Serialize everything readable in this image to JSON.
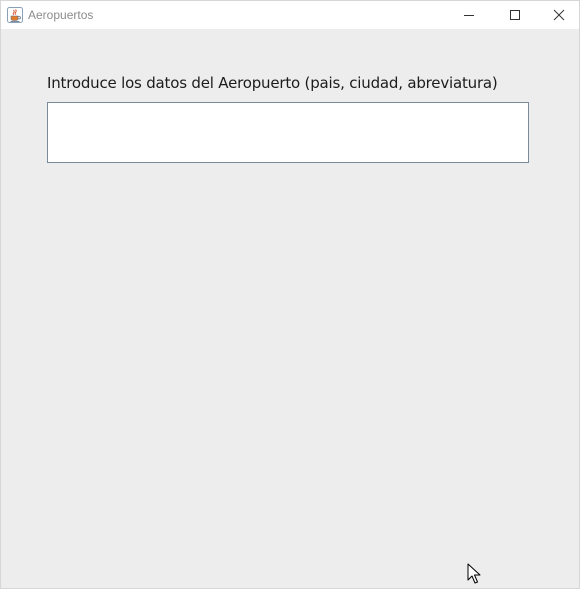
{
  "window": {
    "title": "Aeropuertos",
    "controls": {
      "minimize_icon": "minimize-icon",
      "maximize_icon": "maximize-icon",
      "close_icon": "close-icon"
    },
    "app_icon": "java-cup-icon"
  },
  "form": {
    "prompt": "Introduce los datos del Aeropuerto (pais, ciudad, abreviatura)",
    "input_value": "",
    "input_placeholder": ""
  },
  "colors": {
    "background": "#ededed",
    "titlebar": "#ffffff",
    "input_border": "#7a8a99"
  }
}
